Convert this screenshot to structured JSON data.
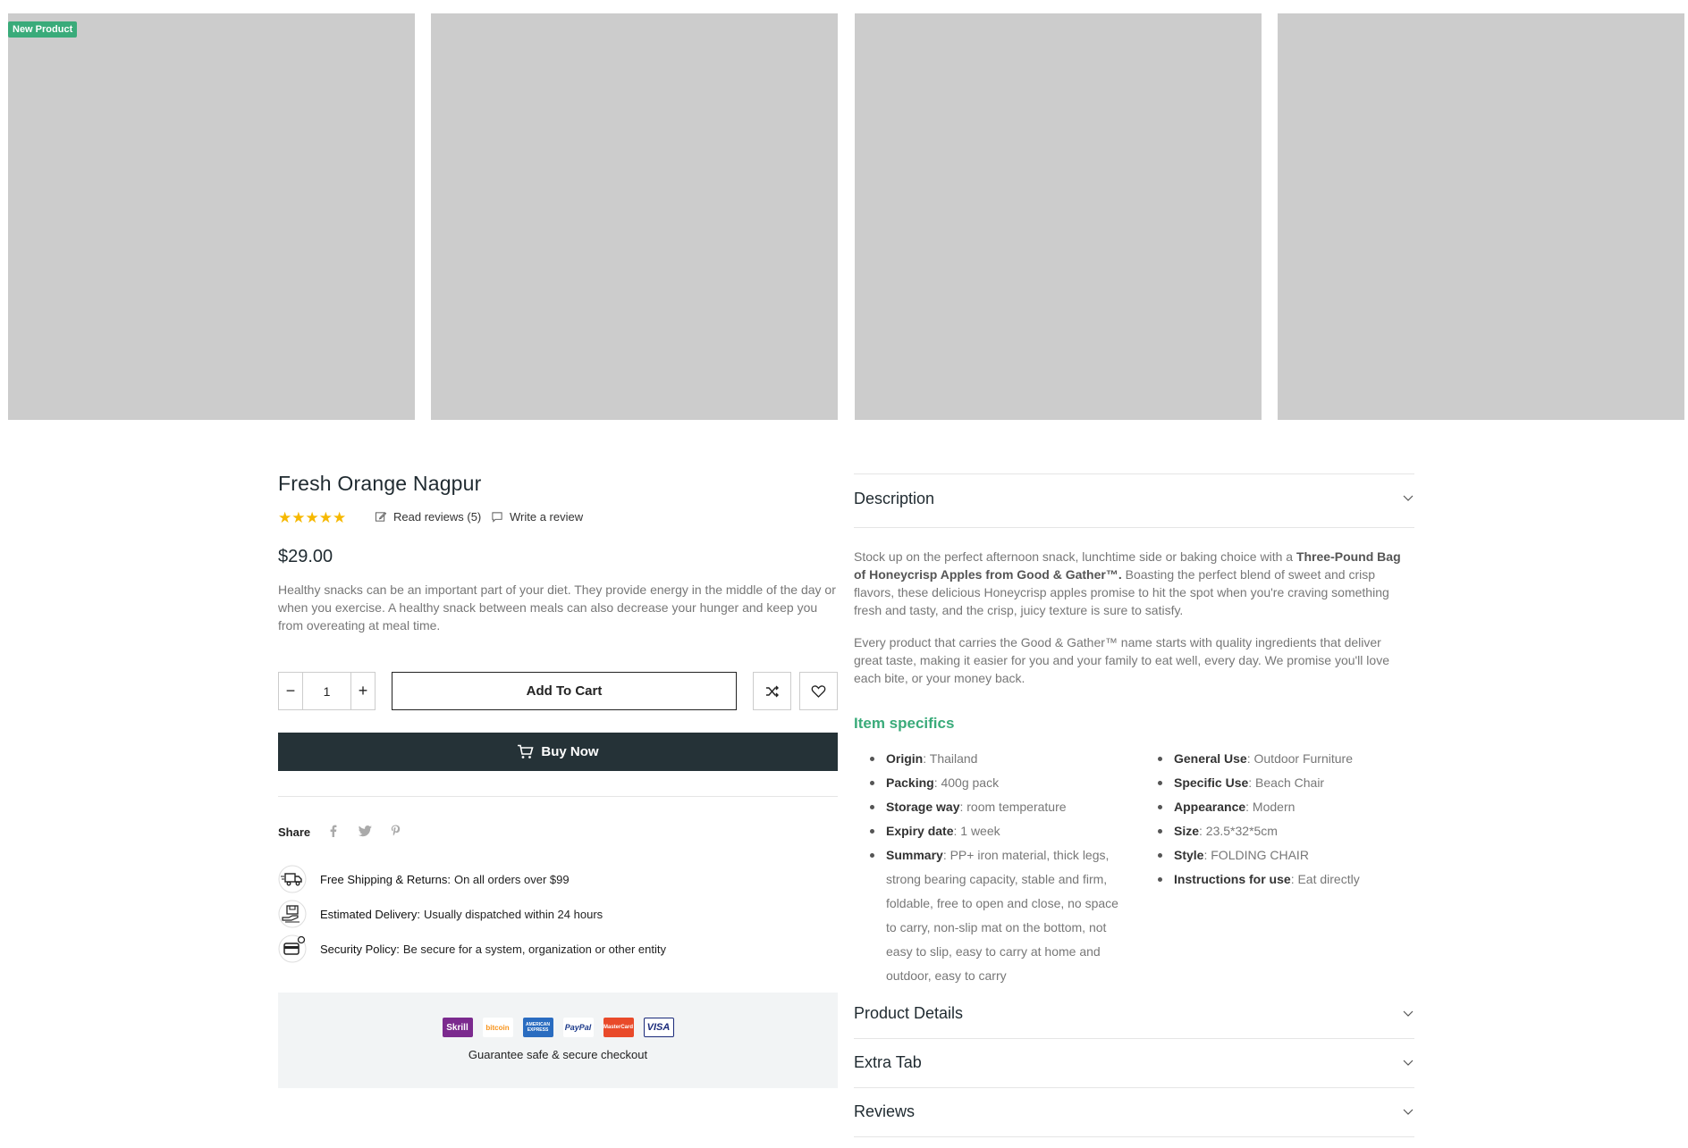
{
  "gallery": {
    "badge": "New Product",
    "images": [
      "",
      "",
      "",
      ""
    ]
  },
  "product": {
    "title": "Fresh Orange Nagpur",
    "rating": 5,
    "stars": "★★★★★",
    "read_reviews": "Read reviews (5)",
    "write_review": "Write a review",
    "price": "$29.00",
    "short_description": "Healthy snacks can be an important part of your diet. They provide energy in the middle of the day or when you exercise. A healthy snack between meals can also decrease your hunger and keep you from overeating at meal time."
  },
  "cart": {
    "minus": "−",
    "quantity": "1",
    "plus": "+",
    "add_to_cart": "Add To Cart",
    "buy_now": "Buy Now"
  },
  "share": {
    "label": "Share",
    "icons": [
      "facebook-icon",
      "twitter-icon",
      "pinterest-icon"
    ]
  },
  "info": [
    {
      "label": "Free Shipping & Returns:",
      "value": "On all orders over $99"
    },
    {
      "label": "Estimated Delivery:",
      "value": "Usually dispatched within 24 hours"
    },
    {
      "label": "Security Policy:",
      "value": "Be secure for a system, organization or other entity"
    }
  ],
  "checkout": {
    "payments": [
      "Skrill",
      "bitcoin",
      "AMERICAN EXPRESS",
      "PayPal",
      "MasterCard",
      "VISA"
    ],
    "text": "Guarantee safe & secure checkout"
  },
  "tabs": {
    "description": "Description",
    "product_details": "Product Details",
    "extra_tab": "Extra Tab",
    "reviews": "Reviews"
  },
  "description": {
    "p1_before": "Stock up on the perfect afternoon snack, lunchtime side or baking choice with a ",
    "p1_bold": "Three-Pound Bag of Honeycrisp Apples from Good & Gather™.",
    "p1_after": " Boasting the perfect blend of sweet and crisp flavors, these delicious Honeycrisp apples promise to hit the spot when you're craving something fresh and tasty, and the crisp, juicy texture is sure to satisfy.",
    "p2": "Every product that carries the Good & Gather™ name starts with quality ingredients that deliver great taste, making it easier for you and your family to eat well, every day. We promise you'll love each bite, or your money back."
  },
  "item_specifics": {
    "title": "Item specifics",
    "left": [
      {
        "key": "Origin",
        "value": ": Thailand"
      },
      {
        "key": "Packing",
        "value": ": 400g pack"
      },
      {
        "key": "Storage way",
        "value": ": room temperature"
      },
      {
        "key": "Expiry date",
        "value": ": 1 week"
      },
      {
        "key": "Summary",
        "value": ": PP+ iron material, thick legs, strong bearing capacity, stable and firm, foldable, free to open and close, no space to carry, non-slip mat on the bottom, not easy to slip, easy to carry at home and outdoor, easy to carry"
      }
    ],
    "right": [
      {
        "key": "General Use",
        "value": ": Outdoor Furniture"
      },
      {
        "key": "Specific Use",
        "value": ": Beach Chair"
      },
      {
        "key": "Appearance",
        "value": ": Modern"
      },
      {
        "key": "Size",
        "value": ": 23.5*32*5cm"
      },
      {
        "key": "Style",
        "value": ": FOLDING CHAIR"
      },
      {
        "key": "Instructions for use",
        "value": ": Eat directly"
      }
    ]
  },
  "colors": {
    "accent": "#3aab7a",
    "dark": "#253237",
    "star": "#f6b800",
    "placeholder": "#cccccc"
  }
}
